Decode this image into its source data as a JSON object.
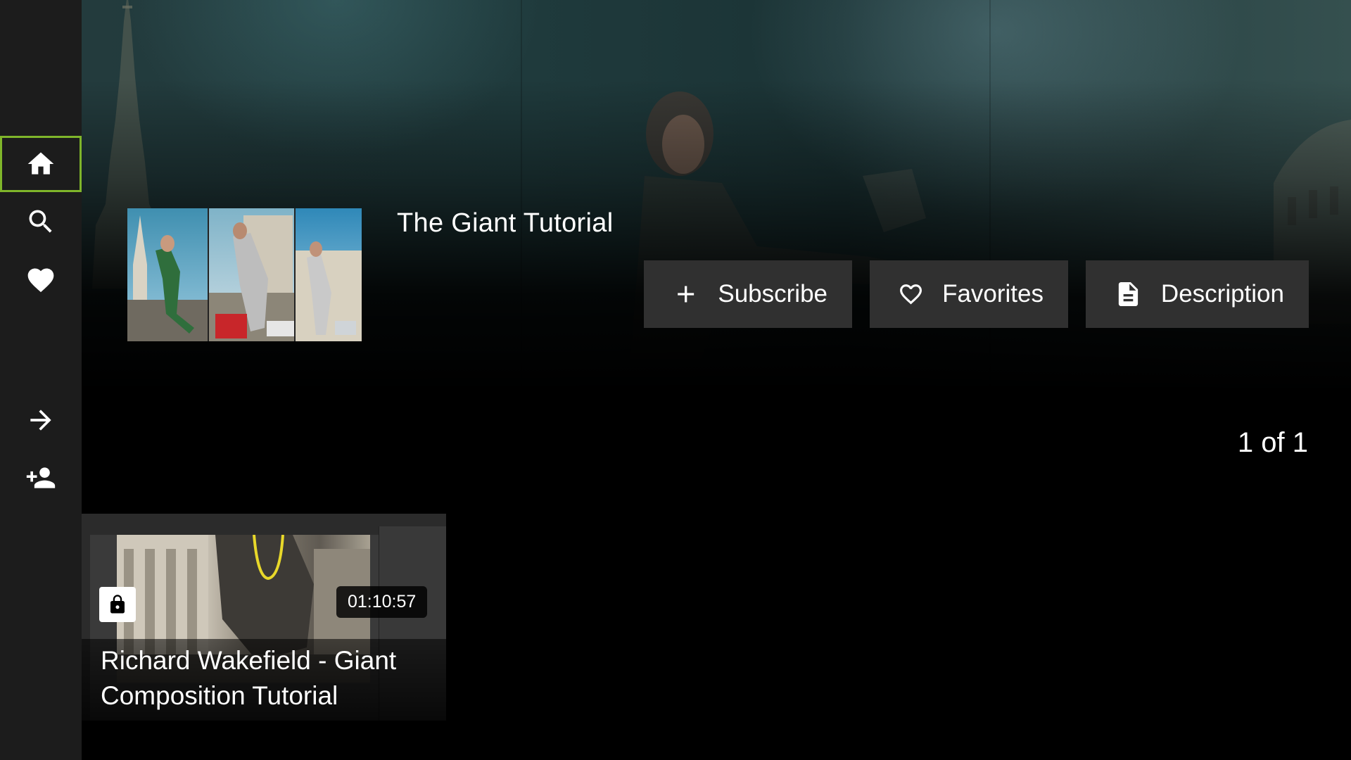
{
  "colors": {
    "sidebar_bg": "#1c1c1c",
    "accent_focus": "#7fb52a",
    "button_bg": "#303030",
    "page_bg": "#000000"
  },
  "sidebar": {
    "items": [
      {
        "name": "home",
        "icon": "home-icon",
        "active": true
      },
      {
        "name": "search",
        "icon": "search-icon",
        "active": false
      },
      {
        "name": "favorites",
        "icon": "heart-icon",
        "active": false
      },
      {
        "name": "sign-in",
        "icon": "arrow-right-icon",
        "active": false
      },
      {
        "name": "add-account",
        "icon": "person-add-icon",
        "active": false
      }
    ]
  },
  "show": {
    "title": "The Giant Tutorial"
  },
  "actions": {
    "subscribe_label": "Subscribe",
    "favorites_label": "Favorites",
    "description_label": "Description"
  },
  "pager": {
    "text": "1 of 1"
  },
  "episodes": [
    {
      "title": "Richard Wakefield - Giant Composition Tutorial",
      "duration": "01:10:57",
      "locked": true
    }
  ]
}
